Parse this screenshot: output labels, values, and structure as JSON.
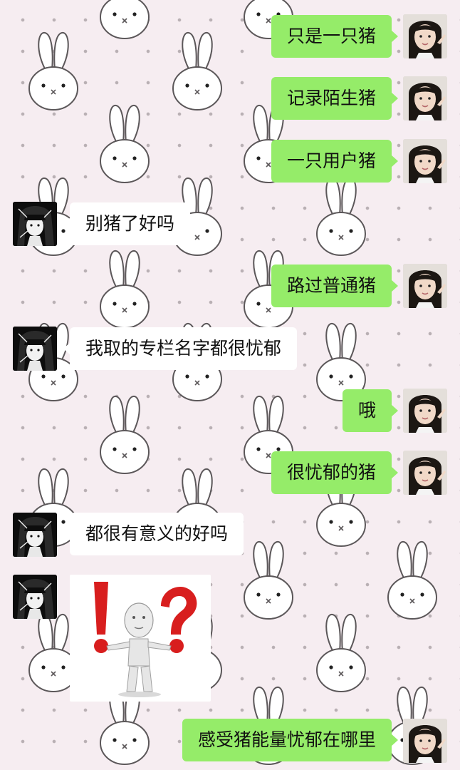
{
  "chat": {
    "messages": [
      {
        "sender": "me",
        "text": "只是一只猪"
      },
      {
        "sender": "me",
        "text": "记录陌生猪"
      },
      {
        "sender": "me",
        "text": "一只用户猪"
      },
      {
        "sender": "friend",
        "text": "别猪了好吗"
      },
      {
        "sender": "me",
        "text": "路过普通猪"
      },
      {
        "sender": "friend",
        "text": "我取的专栏名字都很忧郁"
      },
      {
        "sender": "me",
        "text": "哦"
      },
      {
        "sender": "me",
        "text": "很忧郁的猪"
      },
      {
        "sender": "friend",
        "text": "都很有意义的好吗"
      },
      {
        "sender": "friend",
        "type": "sticker",
        "sticker": "exclamation-question-figure"
      },
      {
        "sender": "me",
        "text": "感受猪能量忧郁在哪里"
      }
    ]
  },
  "theme": {
    "background": "#f6edf1",
    "my_bubble": "#95ec69",
    "friend_bubble": "#ffffff",
    "wallpaper_motif": "bunny-pattern"
  }
}
